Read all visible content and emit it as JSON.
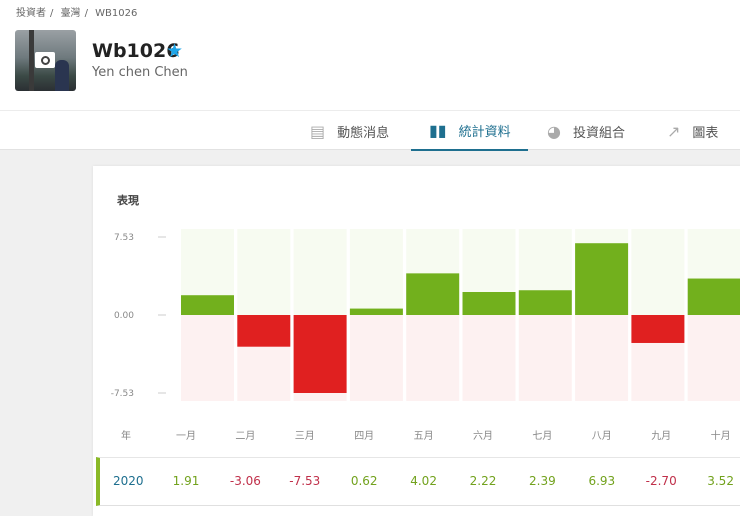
{
  "breadcrumb": [
    "投資者",
    "臺灣",
    "WB1026"
  ],
  "profile": {
    "username": "Wb1026",
    "fullname": "Yen chen Chen"
  },
  "tabs": [
    {
      "label": "動態消息",
      "icon": "feed-icon"
    },
    {
      "label": "統計資料",
      "icon": "bar-chart-icon",
      "active": true
    },
    {
      "label": "投資組合",
      "icon": "pie-chart-icon"
    },
    {
      "label": "圖表",
      "icon": "trend-chart-icon"
    }
  ],
  "section_title": "表現",
  "colors": {
    "positive": "#72b01d",
    "negative": "#e02020",
    "pos_bg": "#f7fbf1",
    "neg_bg": "#fdf1f1"
  },
  "chart_data": {
    "type": "bar",
    "title": "表現",
    "yticks": [
      "7.53",
      "0.00",
      "-7.53"
    ],
    "ylim": [
      -7.53,
      7.53
    ],
    "categories": [
      "一月",
      "二月",
      "三月",
      "四月",
      "五月",
      "六月",
      "七月",
      "八月",
      "九月",
      "十月"
    ],
    "values": [
      1.91,
      -3.06,
      -7.53,
      0.62,
      4.02,
      2.22,
      2.39,
      6.93,
      -2.7,
      3.52
    ]
  },
  "table": {
    "year_header": "年",
    "year": "2020",
    "values": [
      "1.91",
      "-3.06",
      "-7.53",
      "0.62",
      "4.02",
      "2.22",
      "2.39",
      "6.93",
      "-2.70",
      "3.52"
    ]
  }
}
